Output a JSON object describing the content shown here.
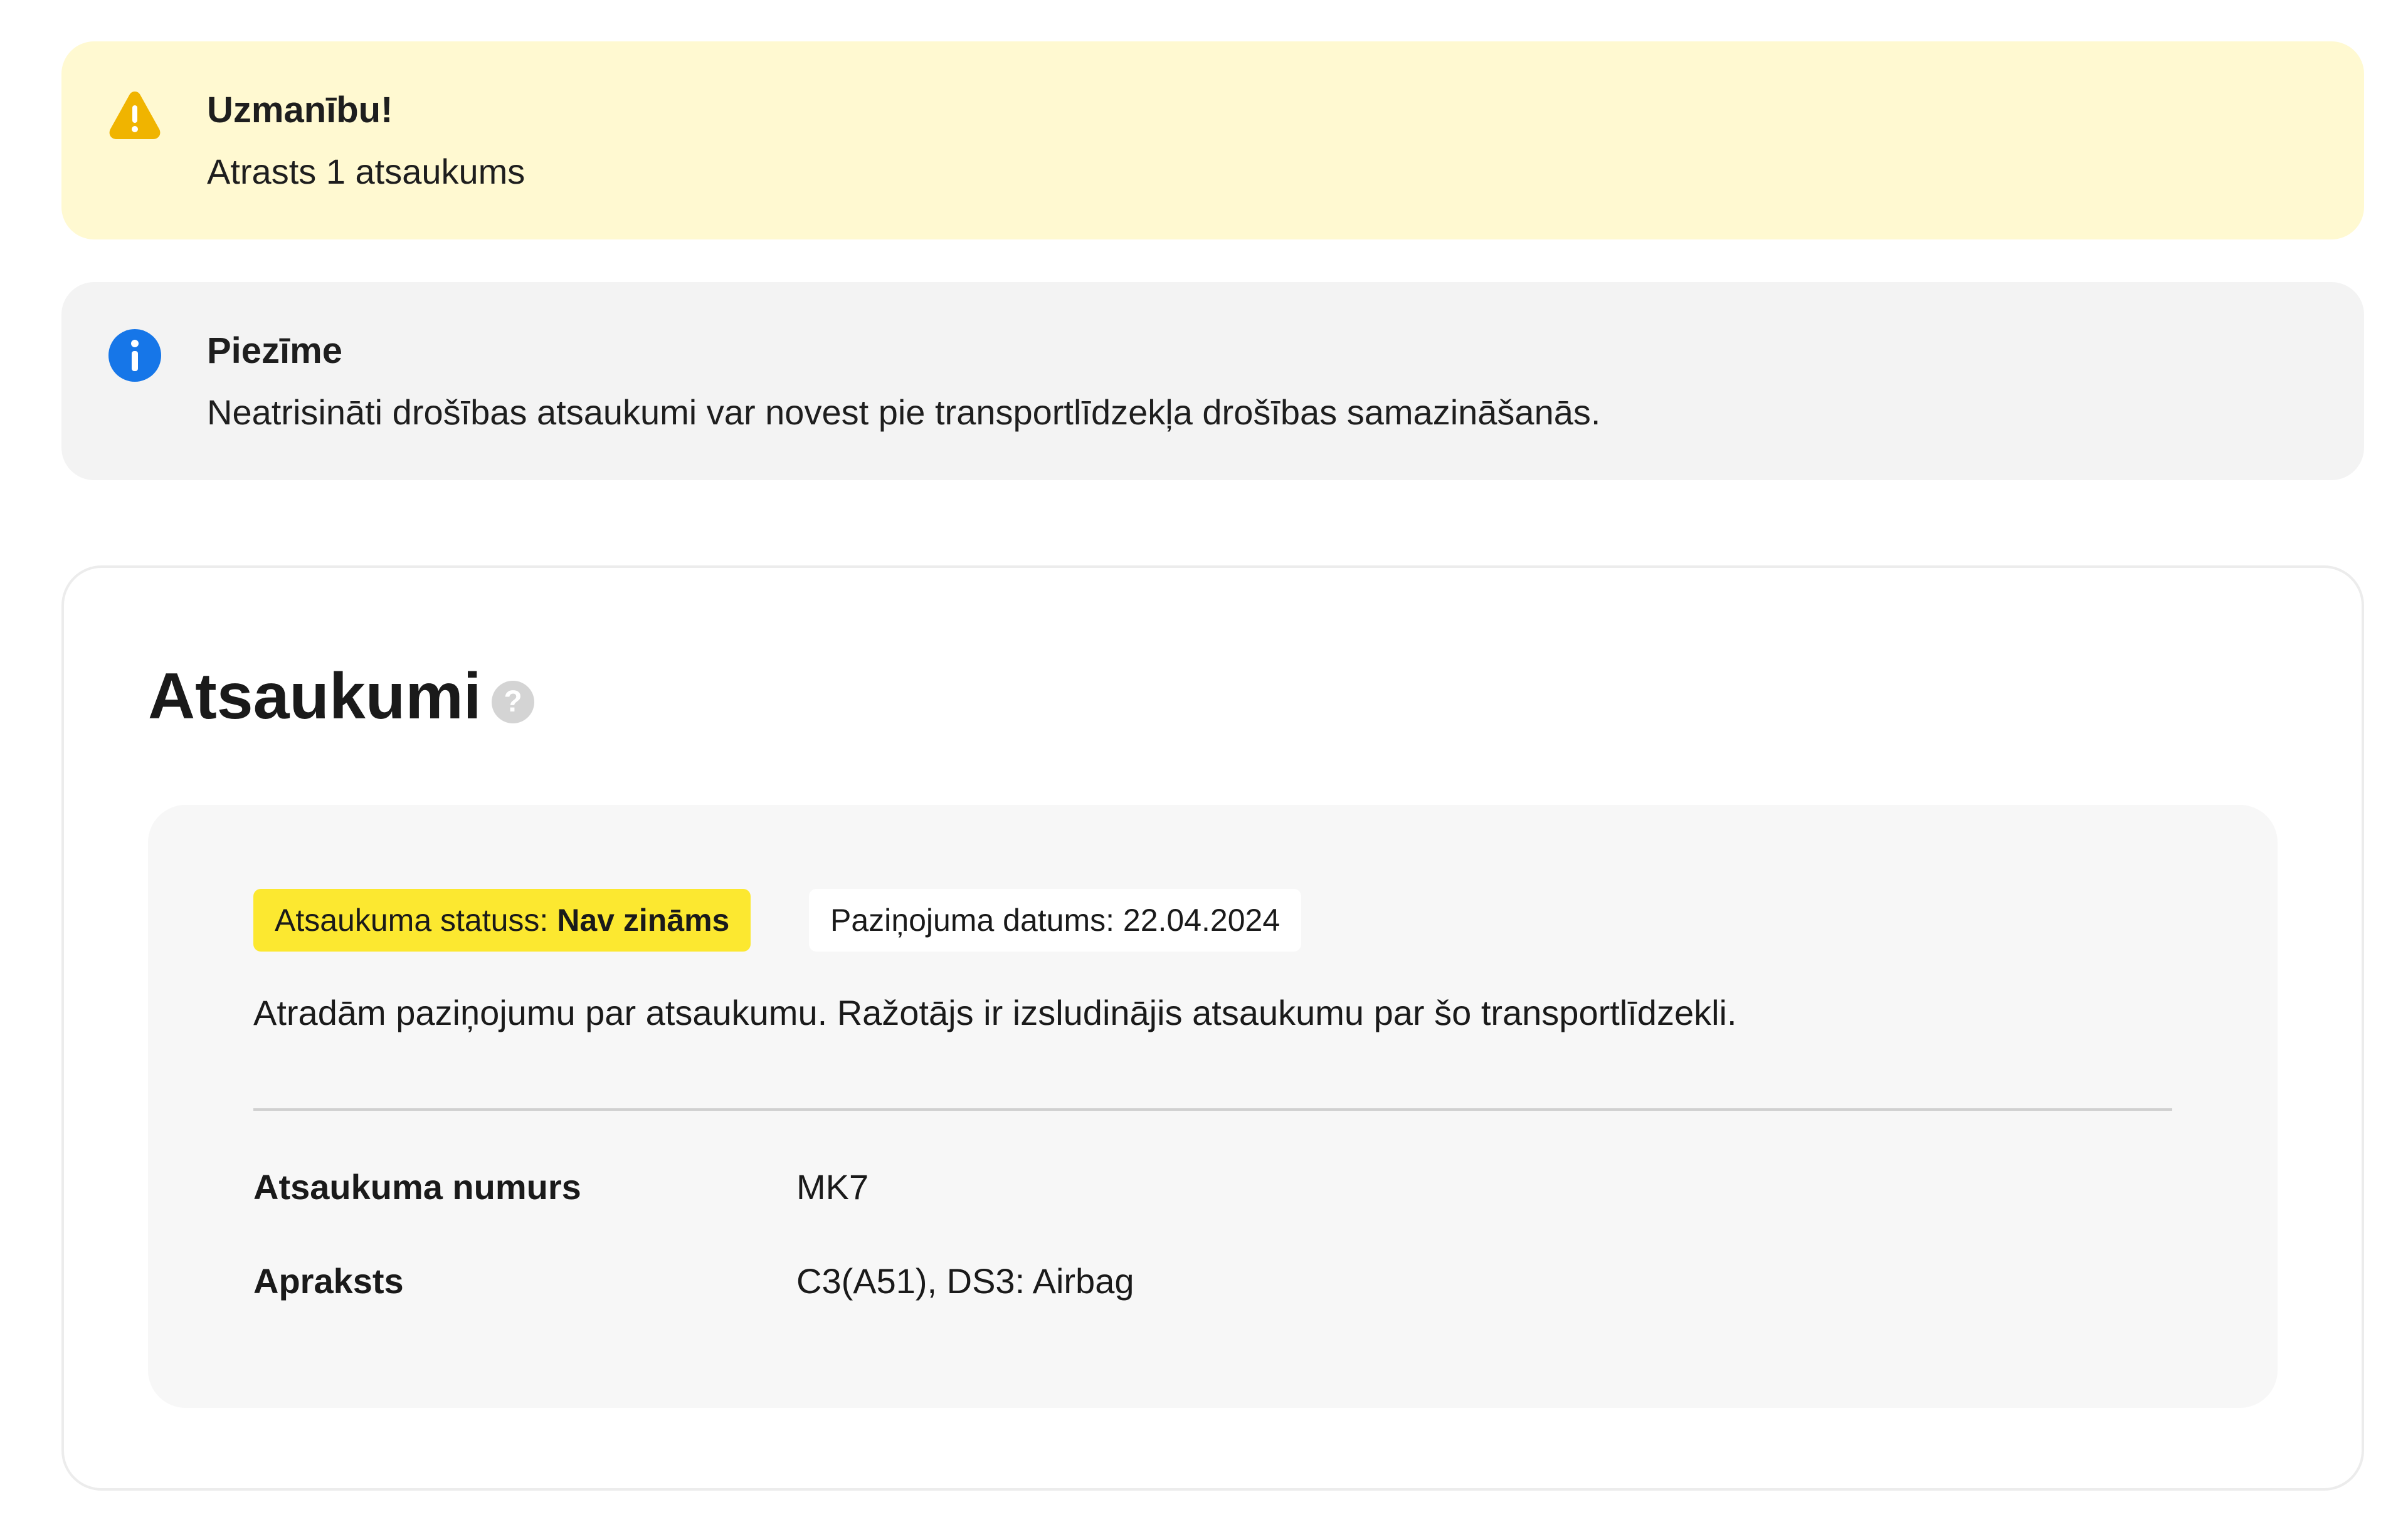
{
  "warning_alert": {
    "icon": "warning-icon",
    "title": "Uzmanību!",
    "text": "Atrasts 1 atsaukums",
    "background": "#fff9d1",
    "icon_color": "#f0b400"
  },
  "info_alert": {
    "icon": "info-icon",
    "title": "Piezīme",
    "text": "Neatrisināti drošības atsaukumi var novest pie transportlīdzekļa drošības samazināšanās.",
    "background": "#f3f3f3",
    "icon_color": "#1676e8"
  },
  "recalls": {
    "title": "Atsaukumi",
    "help_icon": "question-mark-icon",
    "help_glyph": "?",
    "item": {
      "status_label": "Atsaukuma statuss:",
      "status_value": "Nav zināms",
      "status_color": "#fce830",
      "date_label": "Paziņojuma datums:",
      "date_value": "22.04.2024",
      "description": "Atradām paziņojumu par atsaukumu. Ražotājs ir izsludinājis atsaukumu par šo transportlīdzekli.",
      "details": [
        {
          "label": "Atsaukuma numurs",
          "value": "MK7"
        },
        {
          "label": "Apraksts",
          "value": "C3(A51), DS3: Airbag"
        }
      ]
    }
  }
}
